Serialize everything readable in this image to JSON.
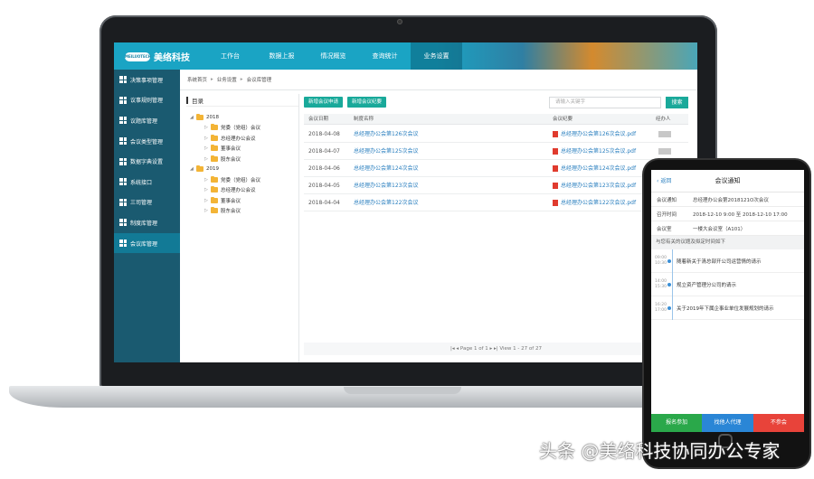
{
  "app": {
    "logo_badge": "MEILUOTECH",
    "brand": "美络科技"
  },
  "nav": [
    "工作台",
    "数据上报",
    "情况概览",
    "查询统计",
    "业务设置"
  ],
  "sidebar": [
    "决策事项管理",
    "议事规则管理",
    "议题库管理",
    "会议类型管理",
    "数据字典设置",
    "系统接口",
    "三司管理",
    "制度库管理",
    "会议库管理"
  ],
  "breadcrumb": [
    "系统首页",
    "业务设置",
    "会议库管理"
  ],
  "tree": {
    "title": "目录",
    "nodes": [
      {
        "label": "2018",
        "level": 0
      },
      {
        "label": "党委（党组）会议",
        "level": 1
      },
      {
        "label": "总经理办公会议",
        "level": 1
      },
      {
        "label": "董事会议",
        "level": 1
      },
      {
        "label": "股东会议",
        "level": 1
      },
      {
        "label": "2019",
        "level": 0
      },
      {
        "label": "党委（党组）会议",
        "level": 1
      },
      {
        "label": "总经理办公会议",
        "level": 1
      },
      {
        "label": "董事会议",
        "level": 1
      },
      {
        "label": "股东会议",
        "level": 1
      }
    ]
  },
  "toolbar": {
    "btn_request": "新增会议申请",
    "btn_minutes": "新增会议纪要",
    "search_placeholder": "请输入关键字",
    "search_btn": "搜索"
  },
  "table": {
    "headers": [
      "会议日期",
      "制度名称",
      "会议纪要",
      "经办人"
    ],
    "rows": [
      {
        "date": "2018-04-08",
        "name": "总经理办公会第126次会议",
        "file": "总经理办公会第126次会议.pdf"
      },
      {
        "date": "2018-04-07",
        "name": "总经理办公会第125次会议",
        "file": "总经理办公会第125次会议.pdf"
      },
      {
        "date": "2018-04-06",
        "name": "总经理办公会第124次会议",
        "file": "总经理办公会第124次会议.pdf"
      },
      {
        "date": "2018-04-05",
        "name": "总经理办公会第123次会议",
        "file": "总经理办公会第123次会议.pdf"
      },
      {
        "date": "2018-04-04",
        "name": "总经理办公会第122次会议",
        "file": "总经理办公会第122次会议.pdf"
      }
    ]
  },
  "pager": {
    "text": "|◂ ◂ Page 1 of 1 ▸ ▸| View 1 - 27 of 27"
  },
  "phone": {
    "back": "返回",
    "title": "会议通知",
    "rows": [
      {
        "label": "会议通知",
        "value": "总经理办公会第2018121O次会议"
      },
      {
        "label": "召开时间",
        "value": "2018-12-10  9:00   至   2018-12-10  17:00"
      },
      {
        "label": "会议室",
        "value": "一楼大会议室（A101）"
      }
    ],
    "note": "与您有关的议题及拟定时间如下",
    "timeline": [
      {
        "time": "09:00\n10:30",
        "text": "随着新关于清总部开公司运营情的请示"
      },
      {
        "time": "14:00\n15:30",
        "text": "规立资产管理分公司的请示"
      },
      {
        "time": "16:20\n17:00",
        "text": "关于2019年下属企事业单位发展规划的请示"
      }
    ],
    "actions": [
      {
        "label": "报名参加",
        "color": "#2aa84a"
      },
      {
        "label": "找他人代理",
        "color": "#2a86d6"
      },
      {
        "label": "不参会",
        "color": "#e8433a"
      }
    ]
  },
  "watermark": "头条 @美络科技协同办公专家"
}
